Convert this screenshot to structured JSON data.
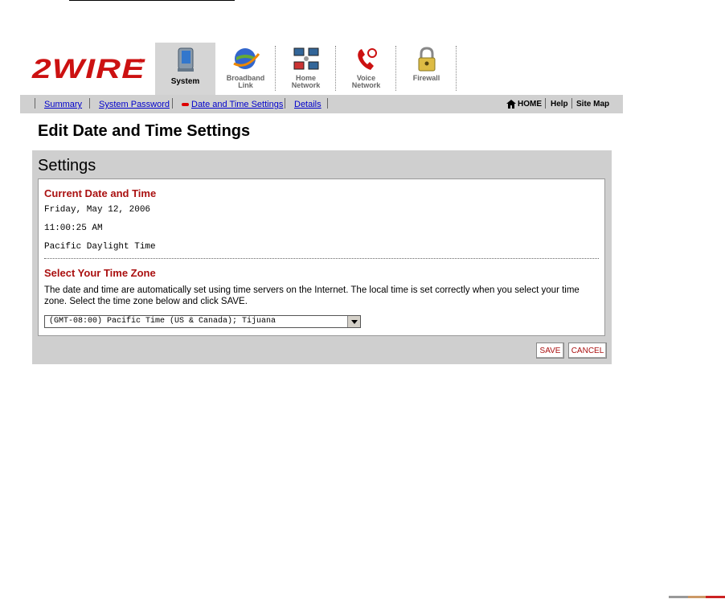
{
  "brand": {
    "logo_text": "2WIRE",
    "registered": "®"
  },
  "tabs": [
    {
      "label_line1": "System",
      "label_line2": "",
      "active": true
    },
    {
      "label_line1": "Broadband",
      "label_line2": "Link",
      "active": false
    },
    {
      "label_line1": "Home",
      "label_line2": "Network",
      "active": false
    },
    {
      "label_line1": "Voice",
      "label_line2": "Network",
      "active": false
    },
    {
      "label_line1": "Firewall",
      "label_line2": "",
      "active": false
    }
  ],
  "subnav": {
    "summary": "Summary",
    "system_password": "System Password",
    "date_time": "Date and Time Settings",
    "details": "Details",
    "home": "HOME",
    "help": "Help",
    "site_map": "Site Map"
  },
  "page": {
    "title": "Edit Date and Time Settings"
  },
  "settings": {
    "panel_title": "Settings",
    "current_heading": "Current Date and Time",
    "date": "Friday, May 12, 2006",
    "time": "11:00:25 AM",
    "zone_name": "Pacific Daylight Time",
    "tz_heading": "Select Your Time Zone",
    "description": "The date and time are automatically set using time servers on the Internet. The local time is set correctly when you select your time zone. Select the time zone below and click SAVE.",
    "timezone_selected": "(GMT-08:00) Pacific Time (US & Canada); Tijuana",
    "save_label": "SAVE",
    "cancel_label": "CANCEL"
  },
  "colors": {
    "accent": "#cc1111",
    "link": "#0000cc",
    "nav_bg": "#d0d0d0"
  }
}
